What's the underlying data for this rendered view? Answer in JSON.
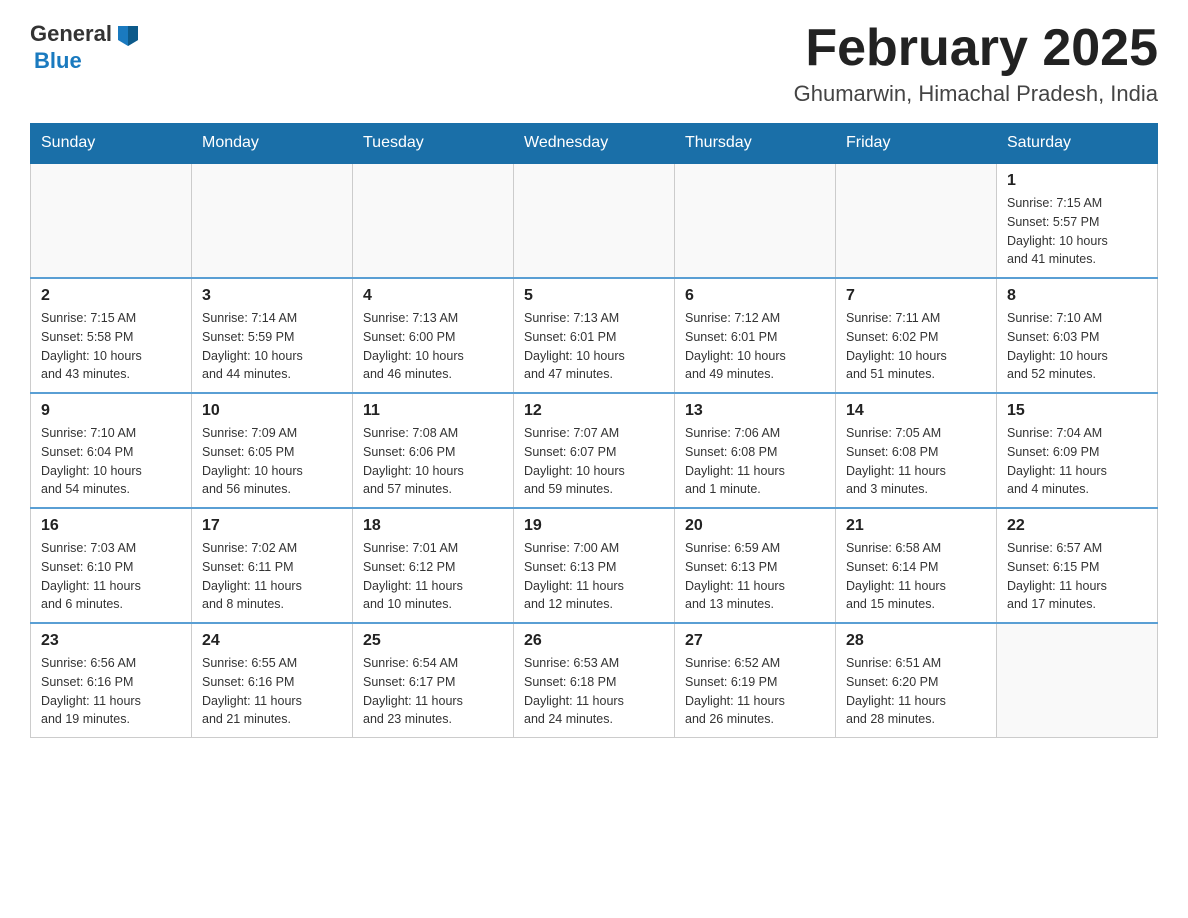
{
  "header": {
    "logo_general": "General",
    "logo_blue": "Blue",
    "month_title": "February 2025",
    "location": "Ghumarwin, Himachal Pradesh, India"
  },
  "weekdays": [
    "Sunday",
    "Monday",
    "Tuesday",
    "Wednesday",
    "Thursday",
    "Friday",
    "Saturday"
  ],
  "weeks": [
    [
      {
        "day": "",
        "info": ""
      },
      {
        "day": "",
        "info": ""
      },
      {
        "day": "",
        "info": ""
      },
      {
        "day": "",
        "info": ""
      },
      {
        "day": "",
        "info": ""
      },
      {
        "day": "",
        "info": ""
      },
      {
        "day": "1",
        "info": "Sunrise: 7:15 AM\nSunset: 5:57 PM\nDaylight: 10 hours\nand 41 minutes."
      }
    ],
    [
      {
        "day": "2",
        "info": "Sunrise: 7:15 AM\nSunset: 5:58 PM\nDaylight: 10 hours\nand 43 minutes."
      },
      {
        "day": "3",
        "info": "Sunrise: 7:14 AM\nSunset: 5:59 PM\nDaylight: 10 hours\nand 44 minutes."
      },
      {
        "day": "4",
        "info": "Sunrise: 7:13 AM\nSunset: 6:00 PM\nDaylight: 10 hours\nand 46 minutes."
      },
      {
        "day": "5",
        "info": "Sunrise: 7:13 AM\nSunset: 6:01 PM\nDaylight: 10 hours\nand 47 minutes."
      },
      {
        "day": "6",
        "info": "Sunrise: 7:12 AM\nSunset: 6:01 PM\nDaylight: 10 hours\nand 49 minutes."
      },
      {
        "day": "7",
        "info": "Sunrise: 7:11 AM\nSunset: 6:02 PM\nDaylight: 10 hours\nand 51 minutes."
      },
      {
        "day": "8",
        "info": "Sunrise: 7:10 AM\nSunset: 6:03 PM\nDaylight: 10 hours\nand 52 minutes."
      }
    ],
    [
      {
        "day": "9",
        "info": "Sunrise: 7:10 AM\nSunset: 6:04 PM\nDaylight: 10 hours\nand 54 minutes."
      },
      {
        "day": "10",
        "info": "Sunrise: 7:09 AM\nSunset: 6:05 PM\nDaylight: 10 hours\nand 56 minutes."
      },
      {
        "day": "11",
        "info": "Sunrise: 7:08 AM\nSunset: 6:06 PM\nDaylight: 10 hours\nand 57 minutes."
      },
      {
        "day": "12",
        "info": "Sunrise: 7:07 AM\nSunset: 6:07 PM\nDaylight: 10 hours\nand 59 minutes."
      },
      {
        "day": "13",
        "info": "Sunrise: 7:06 AM\nSunset: 6:08 PM\nDaylight: 11 hours\nand 1 minute."
      },
      {
        "day": "14",
        "info": "Sunrise: 7:05 AM\nSunset: 6:08 PM\nDaylight: 11 hours\nand 3 minutes."
      },
      {
        "day": "15",
        "info": "Sunrise: 7:04 AM\nSunset: 6:09 PM\nDaylight: 11 hours\nand 4 minutes."
      }
    ],
    [
      {
        "day": "16",
        "info": "Sunrise: 7:03 AM\nSunset: 6:10 PM\nDaylight: 11 hours\nand 6 minutes."
      },
      {
        "day": "17",
        "info": "Sunrise: 7:02 AM\nSunset: 6:11 PM\nDaylight: 11 hours\nand 8 minutes."
      },
      {
        "day": "18",
        "info": "Sunrise: 7:01 AM\nSunset: 6:12 PM\nDaylight: 11 hours\nand 10 minutes."
      },
      {
        "day": "19",
        "info": "Sunrise: 7:00 AM\nSunset: 6:13 PM\nDaylight: 11 hours\nand 12 minutes."
      },
      {
        "day": "20",
        "info": "Sunrise: 6:59 AM\nSunset: 6:13 PM\nDaylight: 11 hours\nand 13 minutes."
      },
      {
        "day": "21",
        "info": "Sunrise: 6:58 AM\nSunset: 6:14 PM\nDaylight: 11 hours\nand 15 minutes."
      },
      {
        "day": "22",
        "info": "Sunrise: 6:57 AM\nSunset: 6:15 PM\nDaylight: 11 hours\nand 17 minutes."
      }
    ],
    [
      {
        "day": "23",
        "info": "Sunrise: 6:56 AM\nSunset: 6:16 PM\nDaylight: 11 hours\nand 19 minutes."
      },
      {
        "day": "24",
        "info": "Sunrise: 6:55 AM\nSunset: 6:16 PM\nDaylight: 11 hours\nand 21 minutes."
      },
      {
        "day": "25",
        "info": "Sunrise: 6:54 AM\nSunset: 6:17 PM\nDaylight: 11 hours\nand 23 minutes."
      },
      {
        "day": "26",
        "info": "Sunrise: 6:53 AM\nSunset: 6:18 PM\nDaylight: 11 hours\nand 24 minutes."
      },
      {
        "day": "27",
        "info": "Sunrise: 6:52 AM\nSunset: 6:19 PM\nDaylight: 11 hours\nand 26 minutes."
      },
      {
        "day": "28",
        "info": "Sunrise: 6:51 AM\nSunset: 6:20 PM\nDaylight: 11 hours\nand 28 minutes."
      },
      {
        "day": "",
        "info": ""
      }
    ]
  ]
}
